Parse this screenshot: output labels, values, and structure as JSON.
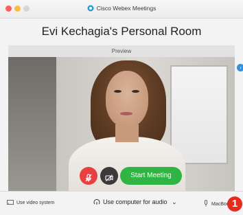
{
  "window": {
    "title": "Cisco Webex Meetings",
    "logo_icon": "webex-logo-icon"
  },
  "room": {
    "title": "Evi Kechagia's Personal Room"
  },
  "preview": {
    "label": "Preview"
  },
  "controls": {
    "mute_icon": "microphone-muted-icon",
    "video_icon": "video-off-icon",
    "start_label": "Start Meeting"
  },
  "bottom_bar": {
    "video_system_label": "Use video system",
    "audio_label": "Use computer for audio",
    "device_label": "MacBoo"
  },
  "annotation": {
    "badge_number": "1"
  },
  "colors": {
    "mute_red": "#e83f3f",
    "start_green": "#30b443",
    "badge_red": "#e52b1c",
    "accent_blue": "#2f8fe0"
  }
}
